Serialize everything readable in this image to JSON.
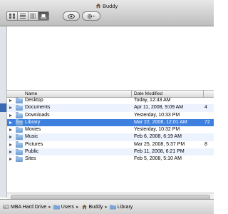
{
  "window": {
    "title": "Buddy"
  },
  "toolbar": {
    "view_buttons": [
      "icon-view",
      "list-view",
      "column-view",
      "coverflow-view"
    ],
    "active_view": "coverflow-view",
    "quicklook": "eye-icon",
    "action": "gear-icon"
  },
  "list": {
    "headers": {
      "name": "Name",
      "date": "Date Modified"
    },
    "rows": [
      {
        "name": "Desktop",
        "date": "Today, 12:43 AM",
        "size": ""
      },
      {
        "name": "Documents",
        "date": "Apr 11, 2008, 9:09 AM",
        "size": "4"
      },
      {
        "name": "Downloads",
        "date": "Yesterday, 10:33 PM",
        "size": ""
      },
      {
        "name": "Library",
        "date": "Mar 22, 2008, 12:01 AM",
        "size": "72"
      },
      {
        "name": "Movies",
        "date": "Yesterday, 10:32 PM",
        "size": ""
      },
      {
        "name": "Music",
        "date": "Feb 6, 2008, 6:19 AM",
        "size": ""
      },
      {
        "name": "Pictures",
        "date": "Mar 25, 2008, 5:37 PM",
        "size": "8"
      },
      {
        "name": "Public",
        "date": "Feb 11, 2008, 6:21 PM",
        "size": ""
      },
      {
        "name": "Sites",
        "date": "Feb 5, 2008, 5:10 AM",
        "size": ""
      }
    ],
    "selected_index": 3
  },
  "pathbar": {
    "items": [
      {
        "label": "MBA Hard Drive",
        "icon": "hard-drive-icon"
      },
      {
        "label": "Users",
        "icon": "folder-icon"
      },
      {
        "label": "Buddy",
        "icon": "home-icon"
      },
      {
        "label": "Library",
        "icon": "folder-icon"
      }
    ],
    "separator": "▸"
  },
  "colors": {
    "selection": "#3d80df",
    "alternate_row": "#edf3fe",
    "folder": "#6d9ad0"
  }
}
